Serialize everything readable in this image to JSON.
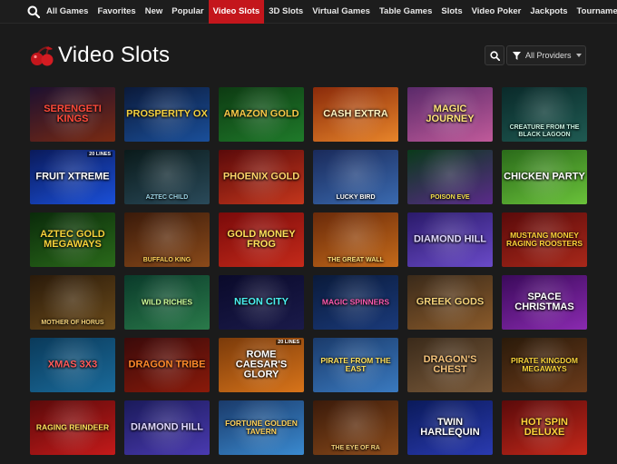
{
  "nav": {
    "items": [
      {
        "label": "All Games",
        "active": false
      },
      {
        "label": "Favorites",
        "active": false
      },
      {
        "label": "New",
        "active": false
      },
      {
        "label": "Popular",
        "active": false
      },
      {
        "label": "Video Slots",
        "active": true
      },
      {
        "label": "3D Slots",
        "active": false
      },
      {
        "label": "Virtual Games",
        "active": false
      },
      {
        "label": "Table Games",
        "active": false
      },
      {
        "label": "Slots",
        "active": false
      },
      {
        "label": "Video Poker",
        "active": false
      },
      {
        "label": "Jackpots",
        "active": false
      },
      {
        "label": "Tournaments",
        "active": false
      }
    ]
  },
  "header": {
    "title": "Video Slots",
    "provider_label": "All Providers"
  },
  "colors": {
    "accent": "#c4161c",
    "background": "#1b1b1b"
  },
  "games": [
    {
      "name": "SERENGETI KINGS",
      "c1": "#1c1030",
      "c2": "#7a2a12",
      "fg": "#ff4a3a"
    },
    {
      "name": "PROSPERITY OX",
      "c1": "#0b1a3a",
      "c2": "#1a4f9a",
      "fg": "#f4d03f"
    },
    {
      "name": "AMAZON GOLD",
      "c1": "#0d3a12",
      "c2": "#1f7a2a",
      "fg": "#f7c948"
    },
    {
      "name": "CASH EXTRA",
      "c1": "#8a2a0a",
      "c2": "#e8852a",
      "fg": "#fff3c0"
    },
    {
      "name": "MAGIC JOURNEY",
      "c1": "#5a2a6a",
      "c2": "#c05a9a",
      "fg": "#ffe27a"
    },
    {
      "name": "CREATURE FROM THE BLACK LAGOON",
      "c1": "#0a2a2a",
      "c2": "#1f5a52",
      "fg": "#c8f0e0",
      "small": true,
      "bottom": true
    },
    {
      "name": "FRUIT XTREME",
      "c1": "#0a1a5a",
      "c2": "#1a4fd8",
      "fg": "#ffffff",
      "badge": "20 LINES"
    },
    {
      "name": "AZTEC CHILD",
      "c1": "#0a1a1a",
      "c2": "#2a4a5a",
      "fg": "#9ad0e0",
      "small": true,
      "bottom": true
    },
    {
      "name": "PHOENIX GOLD",
      "c1": "#5a0a0a",
      "c2": "#c4361c",
      "fg": "#ffd46a"
    },
    {
      "name": "LUCKY BIRD",
      "c1": "#1a2a5a",
      "c2": "#3a6ab0",
      "fg": "#ffffff",
      "small": true,
      "bottom": true
    },
    {
      "name": "POISON EVE",
      "c1": "#0a3a1a",
      "c2": "#5a2a8a",
      "fg": "#f4e04a",
      "small": true,
      "bottom": true
    },
    {
      "name": "CHICKEN PARTY",
      "c1": "#2a6a1a",
      "c2": "#6ac23a",
      "fg": "#ffffff"
    },
    {
      "name": "AZTEC GOLD MEGAWAYS",
      "c1": "#0a2a0a",
      "c2": "#2a6a1a",
      "fg": "#f7d23a"
    },
    {
      "name": "BUFFALO KING",
      "c1": "#3a1a0a",
      "c2": "#8a4a1a",
      "fg": "#ffd25a",
      "small": true,
      "bottom": true
    },
    {
      "name": "GOLD MONEY FROG",
      "c1": "#7a0a0a",
      "c2": "#c42a1a",
      "fg": "#ffe05a"
    },
    {
      "name": "THE GREAT WALL",
      "c1": "#6a2a0a",
      "c2": "#c46a1a",
      "fg": "#ffe07a",
      "small": true,
      "bottom": true
    },
    {
      "name": "DIAMOND HILL",
      "c1": "#2a1a6a",
      "c2": "#6a4ac8",
      "fg": "#e0d8ff"
    },
    {
      "name": "MUSTANG MONEY RAGING ROOSTERS",
      "c1": "#5a0a0a",
      "c2": "#a8281a",
      "fg": "#ffd23a",
      "small": true
    },
    {
      "name": "MOTHER OF HORUS",
      "c1": "#2a1a0a",
      "c2": "#6a4a1a",
      "fg": "#f4d27a",
      "small": true,
      "bottom": true
    },
    {
      "name": "WILD RICHES",
      "c1": "#0a3a2a",
      "c2": "#2a7a4a",
      "fg": "#d0ff9a",
      "small": true
    },
    {
      "name": "NEON CITY",
      "c1": "#0a0a2a",
      "c2": "#1a1a4a",
      "fg": "#4af0f0"
    },
    {
      "name": "MAGIC SPINNERS",
      "c1": "#0a1a3a",
      "c2": "#1a3a7a",
      "fg": "#ff5ab0",
      "small": true
    },
    {
      "name": "GREEK GODS",
      "c1": "#3a2a1a",
      "c2": "#8a5a2a",
      "fg": "#f4d27a"
    },
    {
      "name": "SPACE CHRISTMAS",
      "c1": "#3a0a5a",
      "c2": "#8a2ab0",
      "fg": "#ffffff"
    },
    {
      "name": "XMAS 3X3",
      "c1": "#0a3a5a",
      "c2": "#1a6a9a",
      "fg": "#ff5a5a"
    },
    {
      "name": "DRAGON TRIBE",
      "c1": "#3a0a0a",
      "c2": "#8a1a0a",
      "fg": "#ff8a2a"
    },
    {
      "name": "ROME CAESAR'S GLORY",
      "c1": "#7a3a0a",
      "c2": "#d8741a",
      "fg": "#ffffff",
      "badge": "20 LINES"
    },
    {
      "name": "PIRATE FROM THE EAST",
      "c1": "#1a3a6a",
      "c2": "#3a7ac0",
      "fg": "#ffe05a",
      "small": true
    },
    {
      "name": "DRAGON'S CHEST",
      "c1": "#3a2a1a",
      "c2": "#7a5a3a",
      "fg": "#f4c27a"
    },
    {
      "name": "PIRATE KINGDOM MEGAWAYS",
      "c1": "#2a1a0a",
      "c2": "#6a3a1a",
      "fg": "#f7d23a",
      "small": true
    },
    {
      "name": "RAGING REINDEER",
      "c1": "#5a0a0a",
      "c2": "#c41a1a",
      "fg": "#ffe05a",
      "small": true
    },
    {
      "name": "DIAMOND HILL",
      "c1": "#1a1a5a",
      "c2": "#4a3ab0",
      "fg": "#e0d8ff"
    },
    {
      "name": "FORTUNE GOLDEN TAVERN",
      "c1": "#1a3a6a",
      "c2": "#3a8ad0",
      "fg": "#ffd25a",
      "small": true
    },
    {
      "name": "THE EYE OF RA",
      "c1": "#3a1a0a",
      "c2": "#8a4a1a",
      "fg": "#f4d27a",
      "small": true,
      "bottom": true
    },
    {
      "name": "TWIN HARLEQUIN",
      "c1": "#0a1a5a",
      "c2": "#2a3ab0",
      "fg": "#ffffff"
    },
    {
      "name": "HOT SPIN DELUXE",
      "c1": "#5a0a0a",
      "c2": "#c4281a",
      "fg": "#ffd23a"
    }
  ]
}
